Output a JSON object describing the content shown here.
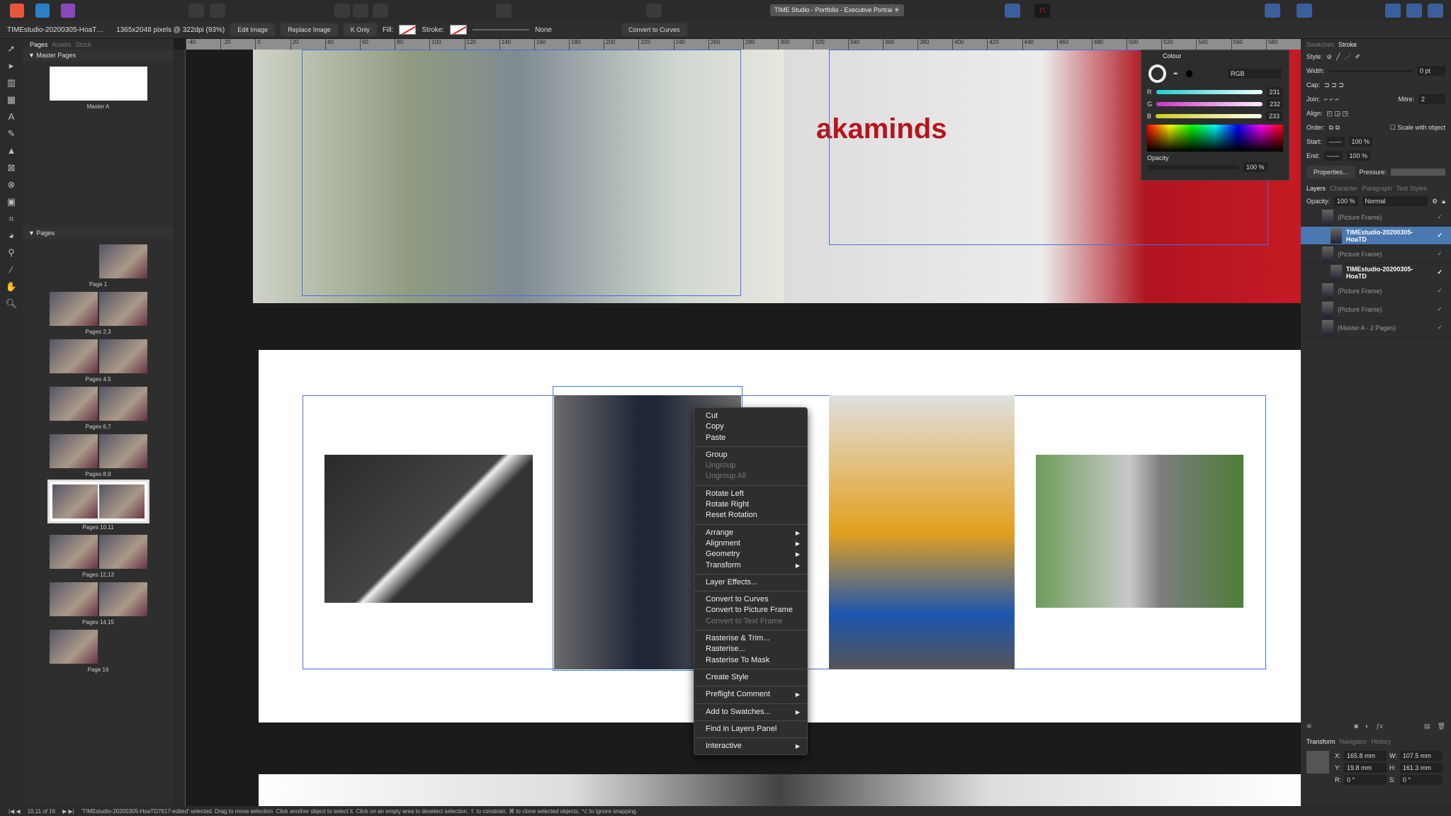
{
  "app": {
    "document_title": "TIME Studio - Portfolio - Executive Portrai ✳"
  },
  "context_toolbar": {
    "filename": "TIMEstudio-20200305-HoaT…",
    "image_info": "1365x2048 pixels @ 322dpi (93%)",
    "edit_image": "Edit Image",
    "replace_image": "Replace Image",
    "k_only": "K Only",
    "fill_label": "Fill:",
    "stroke_label": "Stroke:",
    "stroke_value": "None",
    "convert_to_curves": "Convert to Curves"
  },
  "rulers": {
    "unit": "mm",
    "h_ticks": [
      "-40",
      "-20",
      "0",
      "20",
      "40",
      "60",
      "80",
      "100",
      "120",
      "140",
      "160",
      "180",
      "200",
      "220",
      "240",
      "260",
      "280",
      "300",
      "320",
      "340",
      "360",
      "380",
      "400",
      "420",
      "440",
      "460",
      "480",
      "500",
      "520",
      "540",
      "560",
      "580"
    ]
  },
  "pages_panel": {
    "tabs": [
      "Pages",
      "Assets",
      "Stock"
    ],
    "master_section": "Master Pages",
    "master_name": "Master A",
    "pages_section": "Pages",
    "pages": [
      {
        "label": "Page 1",
        "n": 1
      },
      {
        "label": "Pages 2,3",
        "n": 2
      },
      {
        "label": "Pages 4,5",
        "n": 2
      },
      {
        "label": "Pages 6,7",
        "n": 2
      },
      {
        "label": "Pages 8,9",
        "n": 2
      },
      {
        "label": "Pages 10,11",
        "n": 2,
        "selected": true
      },
      {
        "label": "Pages 12,13",
        "n": 2
      },
      {
        "label": "Pages 14,15",
        "n": 2
      },
      {
        "label": "Page 16",
        "n": 1
      }
    ]
  },
  "canvas": {
    "logo_text": "akaminds"
  },
  "context_menu": {
    "groups": [
      [
        {
          "label": "Cut"
        },
        {
          "label": "Copy"
        },
        {
          "label": "Paste"
        }
      ],
      [
        {
          "label": "Group"
        },
        {
          "label": "Ungroup",
          "disabled": true
        },
        {
          "label": "Ungroup All",
          "disabled": true
        }
      ],
      [
        {
          "label": "Rotate Left"
        },
        {
          "label": "Rotate Right"
        },
        {
          "label": "Reset Rotation"
        }
      ],
      [
        {
          "label": "Arrange",
          "submenu": true
        },
        {
          "label": "Alignment",
          "submenu": true
        },
        {
          "label": "Geometry",
          "submenu": true
        },
        {
          "label": "Transform",
          "submenu": true
        }
      ],
      [
        {
          "label": "Layer Effects..."
        }
      ],
      [
        {
          "label": "Convert to Curves"
        },
        {
          "label": "Convert to Picture Frame"
        },
        {
          "label": "Convert to Text Frame",
          "disabled": true
        }
      ],
      [
        {
          "label": "Rasterise & Trim..."
        },
        {
          "label": "Rasterise..."
        },
        {
          "label": "Rasterise To Mask"
        }
      ],
      [
        {
          "label": "Create Style"
        }
      ],
      [
        {
          "label": "Preflight Comment",
          "submenu": true
        }
      ],
      [
        {
          "label": "Add to Swatches...",
          "submenu": true
        }
      ],
      [
        {
          "label": "Find in Layers Panel"
        }
      ],
      [
        {
          "label": "Interactive",
          "submenu": true
        }
      ]
    ]
  },
  "colour_panel": {
    "title": "Colour",
    "model": "RGB",
    "r": "231",
    "g": "232",
    "b": "233",
    "opacity_label": "Opacity",
    "opacity": "100 %"
  },
  "stroke_panel": {
    "tabs": [
      "Swatches",
      "Stroke"
    ],
    "style": "Style:",
    "width": "Width:",
    "width_value": "0 pt",
    "cap": "Cap:",
    "join": "Join:",
    "mitre": "Mitre:",
    "mitre_value": "2",
    "align": "Align:",
    "order": "Order:",
    "scale": "Scale with object",
    "start": "Start:",
    "end": "End:",
    "start_pct": "100 %",
    "end_pct": "100 %",
    "properties": "Properties...",
    "pressure": "Pressure:"
  },
  "layers_panel": {
    "tabs": [
      "Layers",
      "Character",
      "Paragraph",
      "Text Styles"
    ],
    "opacity_label": "Opacity:",
    "opacity": "100 %",
    "blend": "Normal",
    "layers": [
      {
        "name": "(Picture Frame)",
        "indent": 0
      },
      {
        "name": "TIMEstudio-20200305-HoaTD",
        "indent": 1,
        "selected": true
      },
      {
        "name": "(Picture Frame)",
        "indent": 0
      },
      {
        "name": "TIMEstudio-20200305-HoaTD",
        "indent": 1,
        "bold": true
      },
      {
        "name": "(Picture Frame)",
        "indent": 0
      },
      {
        "name": "(Picture Frame)",
        "indent": 0
      },
      {
        "name": "(Master A - 2 Pages)",
        "indent": 0
      }
    ]
  },
  "transform_panel": {
    "tabs": [
      "Transform",
      "Navigator",
      "History"
    ],
    "x": "165.8 mm",
    "y": "19.8 mm",
    "w": "107.5 mm",
    "h": "161.3 mm",
    "r": "0 °",
    "s": "0 °"
  },
  "status": {
    "page": "10,11 of 16",
    "message": "'TIMEstudio-20200305-HoaTD7617-edited' selected. Drag to move selection. Click another object to select it. Click on an empty area to deselect selection. ⇧ to constrain. ⌘ to clone selected objects. ⌥ to ignore snapping."
  }
}
